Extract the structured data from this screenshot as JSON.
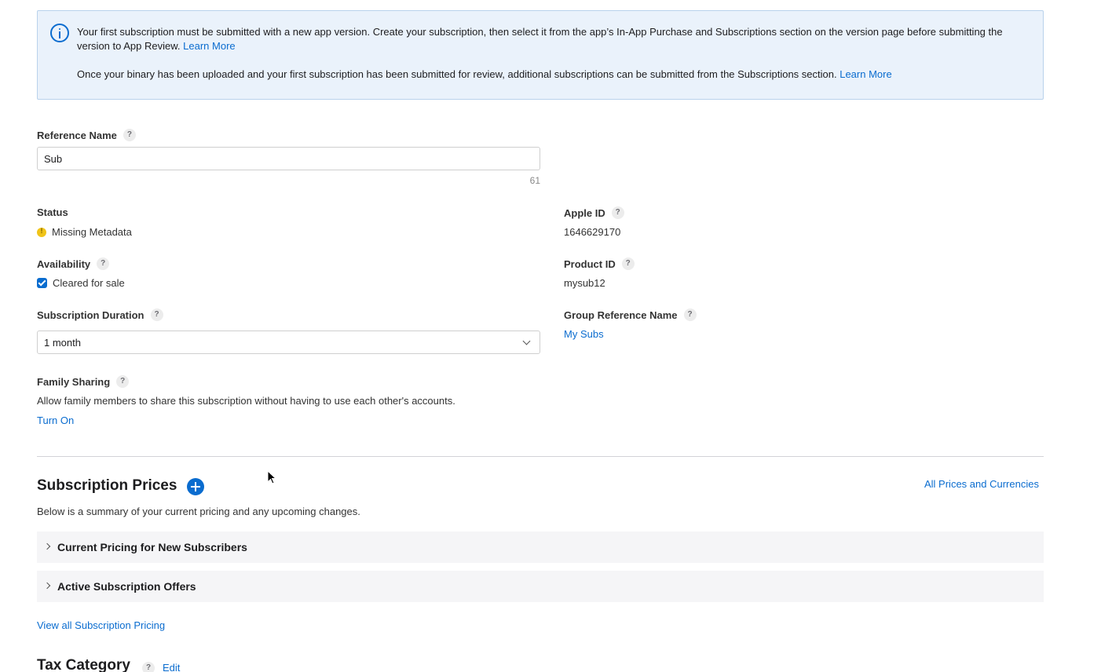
{
  "info_banner": {
    "paragraph1": "Your first subscription must be submitted with a new app version. Create your subscription, then select it from the app’s In-App Purchase and Subscriptions section on the version page before submitting the version to App Review.",
    "paragraph1_link": "Learn More",
    "paragraph2": "Once your binary has been uploaded and your first subscription has been submitted for review, additional subscriptions can be submitted from the Subscriptions section.",
    "paragraph2_link": "Learn More",
    "icon": "info-icon"
  },
  "reference_name": {
    "label": "Reference Name",
    "value": "Sub",
    "remaining_chars": "61"
  },
  "help_glyph": "?",
  "status": {
    "label": "Status",
    "value": "Missing Metadata",
    "color": "#f0c419"
  },
  "apple_id": {
    "label": "Apple ID",
    "value": "1646629170"
  },
  "availability": {
    "label": "Availability",
    "checkbox_label": "Cleared for sale",
    "checked": true
  },
  "product_id": {
    "label": "Product ID",
    "value": "mysub12"
  },
  "subscription_duration": {
    "label": "Subscription Duration",
    "selected": "1 month"
  },
  "group_reference_name": {
    "label": "Group Reference Name",
    "value": "My Subs"
  },
  "family_sharing": {
    "label": "Family Sharing",
    "description": "Allow family members to share this subscription without having to use each other's accounts.",
    "action": "Turn On"
  },
  "subscription_prices": {
    "title": "Subscription Prices",
    "all_prices_link": "All Prices and Currencies",
    "description": "Below is a summary of your current pricing and any upcoming changes.",
    "sections": [
      "Current Pricing for New Subscribers",
      "Active Subscription Offers"
    ],
    "view_all_link": "View all Subscription Pricing"
  },
  "tax_category": {
    "title": "Tax Category",
    "edit_link": "Edit"
  },
  "colors": {
    "accent": "#0a6ccf",
    "banner_bg": "#eaf2fb",
    "warning": "#f0c419"
  }
}
